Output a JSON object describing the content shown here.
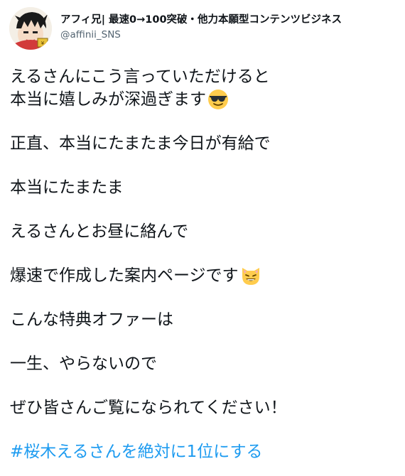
{
  "user": {
    "display_name": "アフィ兄| 最速0→100突破・他力本願型コンテンツビジネス",
    "handle": "@affinii_SNS"
  },
  "tweet": {
    "line1": "えるさんにこう言っていただけると",
    "line2": "本当に嬉しみが深過ぎます",
    "line3": "正直、本当にたまたま今日が有給で",
    "line4": "本当にたまたま",
    "line5": "えるさんとお昼に絡んで",
    "line6": "爆速で作成した案内ページです",
    "line7": "こんな特典オファーは",
    "line8": "一生、やらないので",
    "line9": "ぜひ皆さんご覧になられてください！",
    "hashtag": "#桜木えるさんを絶対に1位にする"
  },
  "icons": {
    "sunglasses_emoji": "smiling-face-with-sunglasses-icon",
    "cat_emoji": "grinning-cat-icon"
  },
  "colors": {
    "text": "#0f1419",
    "handle": "#536471",
    "hashtag": "#1d9bf0"
  }
}
